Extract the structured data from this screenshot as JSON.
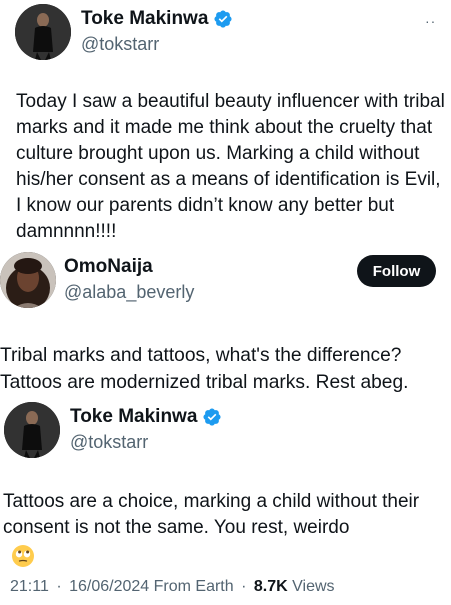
{
  "tweet1": {
    "display_name": "Toke Makinwa",
    "handle": "@tokstarr",
    "more_icon": "··",
    "text": "Today I saw a beautiful beauty influencer with tribal marks and it made me think about the cruelty that culture  brought upon us. Marking a child without his/her consent as a means of identification is Evil, I know our parents didn’t know any better but damnnnn!!!!"
  },
  "tweet2": {
    "display_name": "OmoNaija",
    "handle": "@alaba_beverly",
    "follow_label": "Follow",
    "text": "Tribal marks and tattoos, what's the difference? Tattoos are modernized tribal marks. Rest abeg."
  },
  "tweet3": {
    "display_name": "Toke Makinwa",
    "handle": "@tokstarr",
    "text": "Tattoos are a choice, marking a child without their consent is not the same. You rest, weirdo",
    "emoji": "rolling-eyes-emoji",
    "time": "21:11",
    "date": "16/06/2024",
    "source": "From Earth",
    "views_count": "8.7K",
    "views_label": "Views",
    "separator": "·"
  },
  "colors": {
    "text": "#0f1419",
    "secondary": "#536471",
    "verified_blue": "#1d9bf0",
    "follow_bg": "#0f1419"
  }
}
